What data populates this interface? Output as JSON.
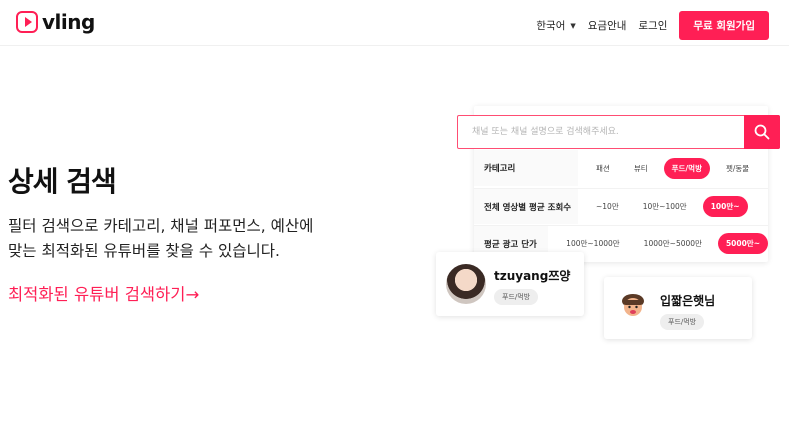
{
  "header": {
    "brand": "vling",
    "nav": {
      "language": "한국어",
      "pricing": "요금안내",
      "login": "로그인",
      "signup": "무료 회원가입"
    }
  },
  "hero": {
    "title": "상세 검색",
    "description_line1": "필터 검색으로 카테고리, 채널 퍼포먼스, 예산에",
    "description_line2": "맞는 최적화된 유튜버를 찾을 수 있습니다.",
    "cta": "최적화된 유튜버 검색하기→"
  },
  "search": {
    "placeholder": "채널 또는 채널 설명으로 검색해주세요."
  },
  "filters": [
    {
      "label": "카테고리",
      "options": [
        "패션",
        "뷰티",
        "푸드/먹방",
        "펫/동물"
      ],
      "selected": "푸드/먹방"
    },
    {
      "label": "전체 영상별 평균 조회수",
      "options": [
        "~10만",
        "10만~100만",
        "100만~"
      ],
      "selected": "100만~"
    },
    {
      "label": "평균 광고 단가",
      "options": [
        "100만~1000만",
        "1000만~5000만",
        "5000만~"
      ],
      "selected": "5000만~"
    }
  ],
  "creators": [
    {
      "name": "tzuyang쯔양",
      "tag": "푸드/먹방"
    },
    {
      "name": "입짧은햇님",
      "tag": "푸드/먹방"
    }
  ],
  "colors": {
    "accent": "#ff1f55"
  }
}
